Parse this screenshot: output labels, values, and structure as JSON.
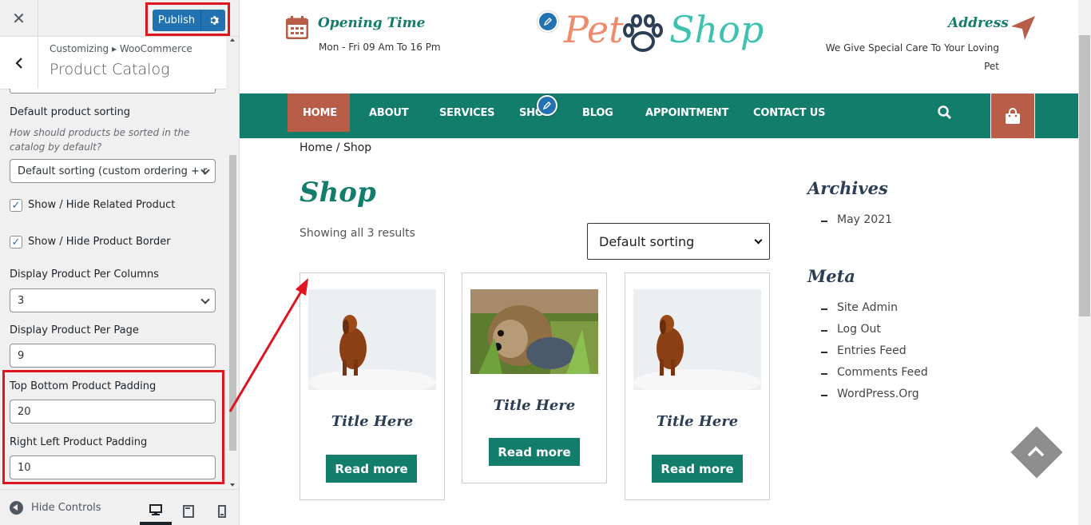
{
  "customizer": {
    "close_icon": "close-icon",
    "publish_label": "Publish",
    "back_icon": "chevron-left-icon",
    "breadcrumb": "Customizing ▸ WooCommerce",
    "section_title": "Product Catalog",
    "default_sorting": {
      "label": "Default product sorting",
      "description": "How should products be sorted in the catalog by default?",
      "value": "Default sorting (custom ordering + r"
    },
    "related_product": {
      "label": "Show / Hide Related Product",
      "checked": true
    },
    "product_border": {
      "label": "Show / Hide Product Border",
      "checked": true
    },
    "per_columns": {
      "label": "Display Product Per Columns",
      "value": "3"
    },
    "per_page": {
      "label": "Display Product Per Page",
      "value": "9"
    },
    "top_bottom_padding": {
      "label": "Top Bottom Product Padding",
      "value": "20"
    },
    "right_left_padding": {
      "label": "Right Left Product Padding",
      "value": "10"
    },
    "footer": {
      "hide_controls": "Hide Controls",
      "active_device": "desktop"
    }
  },
  "site": {
    "opening": {
      "title": "Opening Time",
      "hours": "Mon - Fri 09 Am To 16 Pm"
    },
    "logo": {
      "pet": "Pet",
      "shop": "Shop"
    },
    "address": {
      "title": "Address",
      "text": "We Give Special Care To Your Loving Pet"
    },
    "nav": [
      "HOME",
      "ABOUT",
      "SERVICES",
      "SHOP",
      "BLOG",
      "APPOINTMENT",
      "CONTACT US"
    ],
    "active_nav": "HOME",
    "breadcrumb": "Home / Shop",
    "shop_title": "Shop",
    "result_count": "Showing all 3 results",
    "sort_value": "Default sorting",
    "products": [
      {
        "title": "Title Here",
        "button": "Read more",
        "image": "dog-on-white"
      },
      {
        "title": "Title Here",
        "button": "Read more",
        "image": "yorkie-in-grass"
      },
      {
        "title": "Title Here",
        "button": "Read more",
        "image": "dog-on-white"
      }
    ],
    "archives": {
      "title": "Archives",
      "items": [
        "May 2021"
      ]
    },
    "meta": {
      "title": "Meta",
      "items": [
        "Site Admin",
        "Log Out",
        "Entries Feed",
        "Comments Feed",
        "WordPress.Org"
      ]
    }
  },
  "colors": {
    "teal": "#137d6b",
    "rust": "#b85d48",
    "wp_blue": "#2271b1",
    "highlight_red": "#e0141e"
  }
}
